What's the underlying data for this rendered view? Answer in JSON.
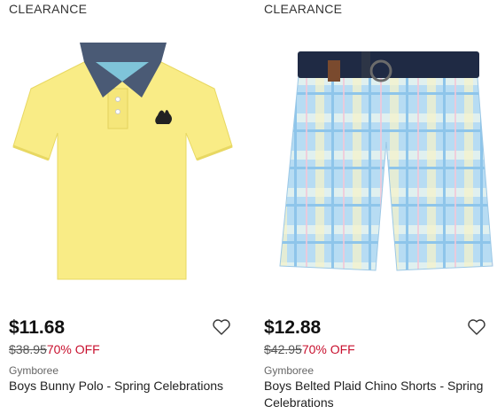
{
  "products": [
    {
      "badge": "CLEARANCE",
      "price": "$11.68",
      "was_price": "$38.95",
      "discount": "70% OFF",
      "brand": "Gymboree",
      "title": "Boys Bunny Polo - Spring Celebrations",
      "image_icon": "yellow-polo-shirt",
      "colors": {
        "body": "#f9ec86",
        "collar": "#4a5a75"
      }
    },
    {
      "badge": "CLEARANCE",
      "price": "$12.88",
      "was_price": "$42.95",
      "discount": "70% OFF",
      "brand": "Gymboree",
      "title": "Boys Belted Plaid Chino Shorts - Spring Celebrations",
      "image_icon": "plaid-shorts",
      "colors": {
        "body": "#a9d3f0",
        "belt": "#1f2a44"
      }
    }
  ],
  "wishlist_icon": "heart-outline-icon",
  "accent_color": "#c8102e"
}
